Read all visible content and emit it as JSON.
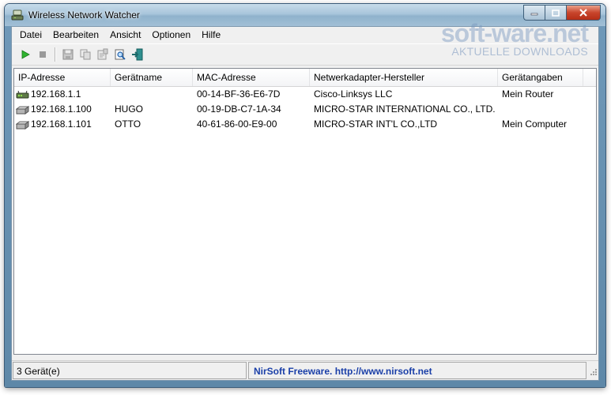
{
  "window": {
    "title": "Wireless Network Watcher",
    "title_icon": "network-watcher-icon",
    "buttons": {
      "minimize": "minimize-icon",
      "maximize": "maximize-icon",
      "close": "close-icon"
    }
  },
  "menu": {
    "items": [
      {
        "label": "Datei"
      },
      {
        "label": "Bearbeiten"
      },
      {
        "label": "Ansicht"
      },
      {
        "label": "Optionen"
      },
      {
        "label": "Hilfe"
      }
    ]
  },
  "toolbar": {
    "buttons": [
      {
        "icon": "play-icon",
        "enabled": true
      },
      {
        "icon": "stop-icon",
        "enabled": false
      },
      {
        "icon": "save-icon",
        "enabled": false
      },
      {
        "icon": "copy-icon",
        "enabled": false
      },
      {
        "icon": "properties-icon",
        "enabled": false
      },
      {
        "icon": "find-icon",
        "enabled": true
      },
      {
        "icon": "exit-icon",
        "enabled": true
      }
    ]
  },
  "table": {
    "columns": [
      "IP-Adresse",
      "Gerätname",
      "MAC-Adresse",
      "Netwerkadapter-Hersteller",
      "Gerätangaben"
    ],
    "rows": [
      {
        "icon": "router-icon",
        "ip": "192.168.1.1",
        "name": "",
        "mac": "00-14-BF-36-E6-7D",
        "vendor": "Cisco-Linksys LLC",
        "info": "Mein Router"
      },
      {
        "icon": "computer-icon",
        "ip": "192.168.1.100",
        "name": "HUGO",
        "mac": "00-19-DB-C7-1A-34",
        "vendor": "MICRO-STAR INTERNATIONAL CO., LTD.",
        "info": ""
      },
      {
        "icon": "computer-icon",
        "ip": "192.168.1.101",
        "name": "OTTO",
        "mac": "40-61-86-00-E9-00",
        "vendor": "MICRO-STAR INT'L CO.,LTD",
        "info": "Mein Computer"
      }
    ]
  },
  "statusbar": {
    "count": "3 Gerät(e)",
    "credit": "NirSoft Freeware.  http://www.nirsoft.net"
  },
  "watermark": {
    "logo": "soft-ware.net",
    "subtitle": "AKTUELLE DOWNLOADS"
  }
}
